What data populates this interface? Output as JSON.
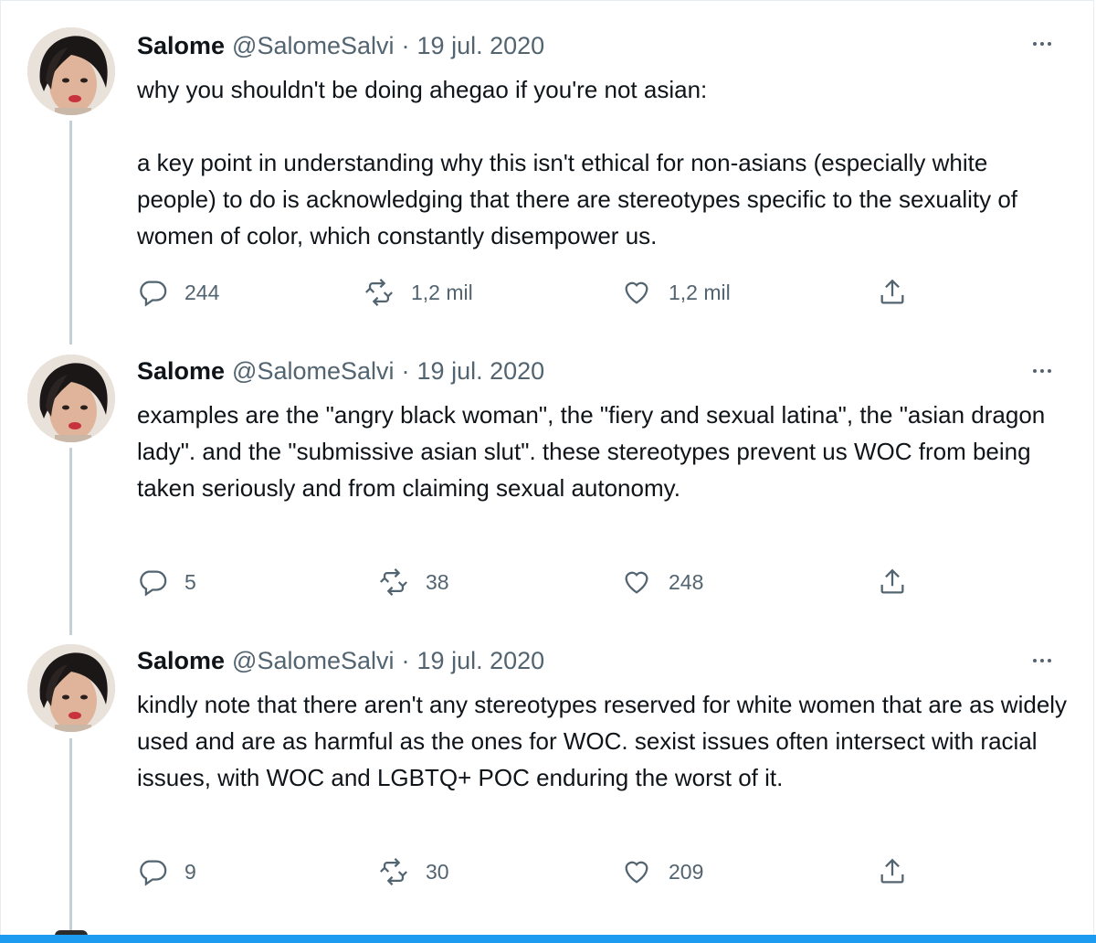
{
  "colors": {
    "accent": "#1d9bf0",
    "muted": "#536471",
    "text": "#0f1419",
    "thread": "#c4cfd6"
  },
  "tweets": [
    {
      "name": "Salome",
      "handle": "@SalomeSalvi",
      "separator": "·",
      "date": "19 jul. 2020",
      "paragraphs": [
        "why you shouldn't be doing ahegao if you're not asian:",
        "",
        "a key point in understanding why this isn't ethical for non-asians (especially white people) to do is acknowledging that there are stereotypes specific to the sexuality of women of color, which constantly disempower us."
      ],
      "replies": "244",
      "retweets": "1,2 mil",
      "likes": "1,2 mil"
    },
    {
      "name": "Salome",
      "handle": "@SalomeSalvi",
      "separator": "·",
      "date": "19 jul. 2020",
      "paragraphs": [
        "examples are the \"angry black woman\", the \"fiery and sexual latina\", the \"asian dragon lady\". and the \"submissive asian slut\". these stereotypes prevent us WOC from being taken seriously and from claiming sexual autonomy."
      ],
      "replies": "5",
      "retweets": "38",
      "likes": "248"
    },
    {
      "name": "Salome",
      "handle": "@SalomeSalvi",
      "separator": "·",
      "date": "19 jul. 2020",
      "paragraphs": [
        "kindly note that there aren't any stereotypes reserved for white women that are as widely used and are as harmful as the ones for WOC. sexist issues often intersect with racial issues, with WOC and LGBTQ+ POC enduring the worst of it."
      ],
      "replies": "9",
      "retweets": "30",
      "likes": "209"
    }
  ],
  "icons": {
    "reply": "reply-icon",
    "retweet": "retweet-icon",
    "like": "heart-icon",
    "share": "share-icon",
    "more": "more-icon"
  }
}
